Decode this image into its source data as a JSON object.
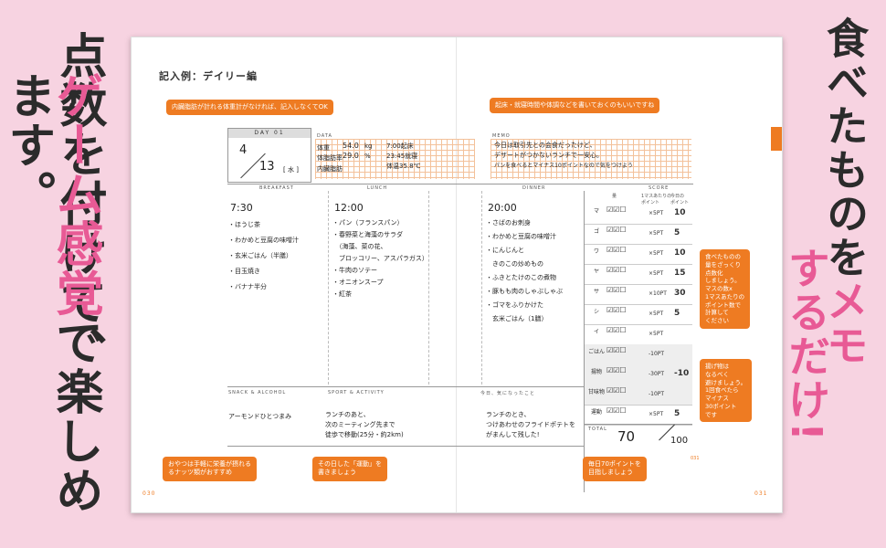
{
  "left_heading": {
    "line1": "点数を付けて、",
    "line2_pink": "ゲーム感覚",
    "line2_rest": "で楽しめます。"
  },
  "right_heading": {
    "line1_a": "食べたものを",
    "line1_b": "メモ",
    "line2_a": "するだけ!"
  },
  "page": {
    "title": "記入例：デイリー編",
    "page_left": "030",
    "page_right": "031",
    "page_right_top": "031"
  },
  "callouts": {
    "top_left": "内臓脂肪が計れる体重計がなければ、記入しなくてOK",
    "top_right": "起床・就寝時間や体調などを書いておくのもいいですね",
    "right_middle": "食べたものの\n量をざっくり\n点数化\nしましょう。\nマスの数x\n1マスあたりの\nポイント数で\n計算して\nください",
    "right_lower": "揚げ物は\nなるべく\n避けましょう。\n1回食べたら\nマイナス\n30ポイント\nです",
    "bottom_left": "おやつは手軽に栄養が摂れる\nるナッツ類がおすすめ",
    "bottom_middle": "その日した「運動」を\n書きましょう",
    "bottom_right": "毎日70ポイントを\n目指しましょう"
  },
  "day": {
    "label": "DAY 01",
    "month": "4",
    "date": "13",
    "weekday": "水",
    "data_label": "DATA",
    "memo_label": "MEMO",
    "weight_label": "体重",
    "weight": "54.0",
    "weight_unit": "kg",
    "fat_label": "体脂肪率",
    "fat": "29.0",
    "fat_unit": "%",
    "visceral_label": "内臓脂肪",
    "wake": "7:00起床",
    "sleep": "23:45就寝",
    "temp": "体温35.8℃",
    "memo1": "今日は取引先との会食だったけど、",
    "memo2": "デザートがつかないランチで一安心。",
    "memo3": "パンを食べるとマイナス10ポイントなので気をつけよう"
  },
  "meals": {
    "breakfast_label": "BREAKFAST",
    "lunch_label": "LUNCH",
    "dinner_label": "DINNER",
    "score_label": "SCORE",
    "breakfast_time": "7:30",
    "lunch_time": "12:00",
    "dinner_time": "20:00",
    "breakfast": [
      "ほうじ茶",
      "わかめと豆腐の味噌汁",
      "玄米ごはん（半膳）",
      "目玉焼き",
      "バナナ半分"
    ],
    "lunch": [
      "パン（フランスパン）",
      "春野菜と海藻のサラダ",
      "（海藻、菜の花、",
      "ブロッコリー、アスパラガス）",
      "牛肉のソテー",
      "オニオンスープ",
      "紅茶"
    ],
    "dinner": [
      "さばのお刺身",
      "わかめと豆腐の味噌汁",
      "にんじんと",
      "きのこの炒めもの",
      "ふきとたけのこの煮物",
      "豚もも肉のしゃぶしゃぶ",
      "ゴマをふりかけた",
      "玄米ごはん（1膳）"
    ]
  },
  "bottom": {
    "snack_label": "SNACK & ALCOHOL",
    "sport_label": "SPORT & ACTIVITY",
    "notes_label": "今日、気になったこと",
    "snack": "アーモンドひとつまみ",
    "sport1": "ランチのあと、",
    "sport2": "次のミーティング先まで",
    "sport3": "徒歩で移動(25分・約2km)",
    "note1": "ランチのとき、",
    "note2": "つけあわせのフライドポテトを",
    "note3": "がまんして残した!"
  },
  "score": {
    "head_count": "量",
    "head_mult": "1マスあたりの\nポイント",
    "head_pts": "今日の\nポイント",
    "rows": [
      {
        "cat": "マ",
        "sub": "（豆類）",
        "mult": "×5PT",
        "pts": "10"
      },
      {
        "cat": "ゴ",
        "sub": "（ゴマ・ナッツ類）",
        "mult": "×5PT",
        "pts": "5"
      },
      {
        "cat": "ワ",
        "sub": "（海藻）",
        "mult": "×5PT",
        "pts": "10"
      },
      {
        "cat": "ヤ",
        "sub": "（野菜）",
        "mult": "×5PT",
        "pts": "15"
      },
      {
        "cat": "サ",
        "sub": "（魚介類）",
        "mult": "×10PT",
        "pts": "30"
      },
      {
        "cat": "シ",
        "sub": "（きのこ）",
        "mult": "×5PT",
        "pts": "5"
      },
      {
        "cat": "イ",
        "sub": "（いも）",
        "mult": "×5PT",
        "pts": ""
      },
      {
        "cat": "ごはん",
        "sub": "",
        "mult": "-10PT",
        "pts": ""
      },
      {
        "cat": "揚物",
        "sub": "",
        "mult": "-30PT",
        "pts": "-10"
      },
      {
        "cat": "甘味物",
        "sub": "",
        "mult": "-10PT",
        "pts": ""
      },
      {
        "cat": "運動",
        "sub": "",
        "mult": "×5PT",
        "pts": "5"
      }
    ],
    "total_label": "TOTAL",
    "total": "70",
    "total_max": "100"
  }
}
